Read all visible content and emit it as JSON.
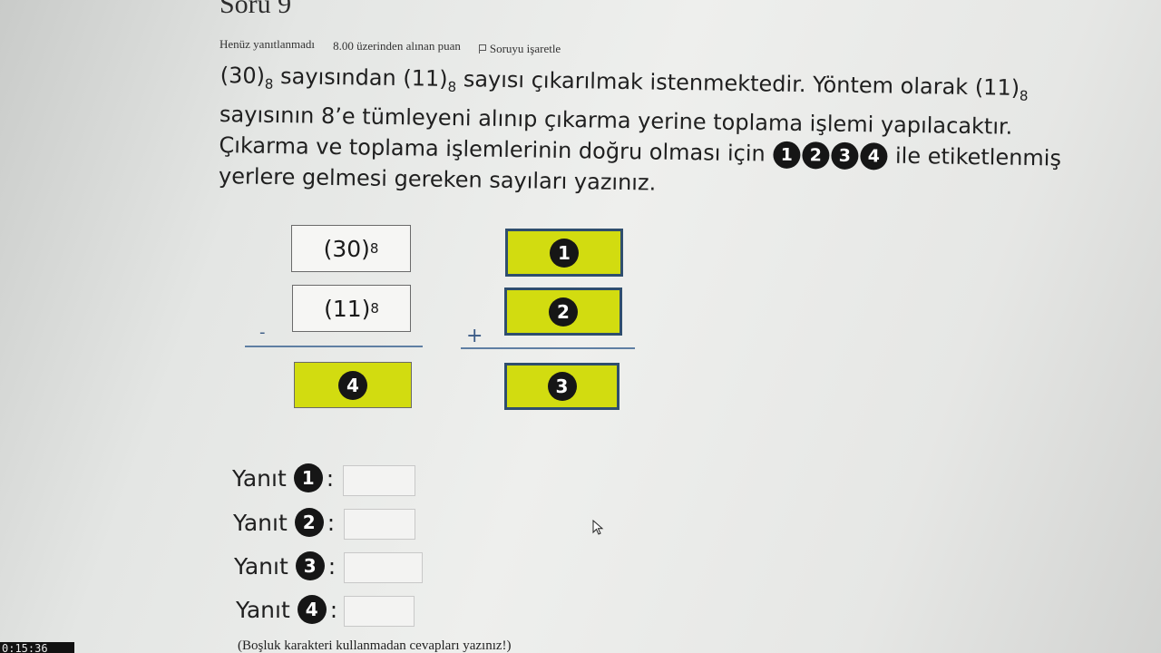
{
  "header": {
    "title": "Soru 9",
    "status": "Henüz yanıtlanmadı",
    "points": "8.00 üzerinden alınan puan",
    "flag_label": "Soruyu işaretle",
    "flag_icon": "flag-icon"
  },
  "question": {
    "part1_base": "(30)",
    "part1_sub": "8",
    "part2": " sayısından ",
    "part3_base": "(11)",
    "part3_sub": "8",
    "part4": " sayısı çıkarılmak istenmektedir. Yöntem olarak ",
    "part5_base": "(11)",
    "part5_sub": "8",
    "part6": " sayısının 8’e tümleyeni alınıp çıkarma yerine toplama işlemi yapılacaktır. Çıkarma ve toplama işlemlerinin doğru olması için ",
    "markers": [
      "1",
      "2",
      "3",
      "4"
    ],
    "part7": " ile etiketlenmiş yerlere gelmesi gereken sayıları yazınız."
  },
  "diagram": {
    "left_top_base": "(30)",
    "left_top_sub": "8",
    "left_mid_base": "(11)",
    "left_mid_sub": "8",
    "left_op": "-",
    "left_result": "4",
    "right_top": "1",
    "right_mid": "2",
    "right_op": "+",
    "right_result": "3",
    "highlight_color": "#d2dc10",
    "border_color": "#2f4e6e"
  },
  "answers": [
    {
      "label": "Yanıt",
      "marker": "1",
      "value": ""
    },
    {
      "label": "Yanıt",
      "marker": "2",
      "value": ""
    },
    {
      "label": "Yanıt",
      "marker": "3",
      "value": ""
    },
    {
      "label": "Yanıt",
      "marker": "4",
      "value": ""
    }
  ],
  "answer_colon": ":",
  "note": "(Boşluk karakteri kullanmadan cevapları yazınız!)",
  "timer": "0:15:36"
}
